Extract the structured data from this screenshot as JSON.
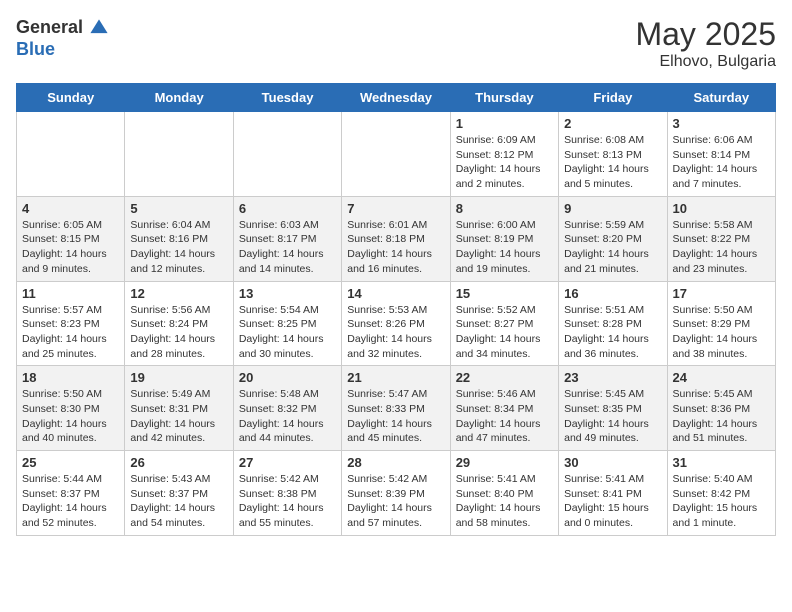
{
  "logo": {
    "general": "General",
    "blue": "Blue"
  },
  "title": {
    "month_year": "May 2025",
    "location": "Elhovo, Bulgaria"
  },
  "weekdays": [
    "Sunday",
    "Monday",
    "Tuesday",
    "Wednesday",
    "Thursday",
    "Friday",
    "Saturday"
  ],
  "weeks": [
    [
      {
        "day": "",
        "info": ""
      },
      {
        "day": "",
        "info": ""
      },
      {
        "day": "",
        "info": ""
      },
      {
        "day": "",
        "info": ""
      },
      {
        "day": "1",
        "info": "Sunrise: 6:09 AM\nSunset: 8:12 PM\nDaylight: 14 hours\nand 2 minutes."
      },
      {
        "day": "2",
        "info": "Sunrise: 6:08 AM\nSunset: 8:13 PM\nDaylight: 14 hours\nand 5 minutes."
      },
      {
        "day": "3",
        "info": "Sunrise: 6:06 AM\nSunset: 8:14 PM\nDaylight: 14 hours\nand 7 minutes."
      }
    ],
    [
      {
        "day": "4",
        "info": "Sunrise: 6:05 AM\nSunset: 8:15 PM\nDaylight: 14 hours\nand 9 minutes."
      },
      {
        "day": "5",
        "info": "Sunrise: 6:04 AM\nSunset: 8:16 PM\nDaylight: 14 hours\nand 12 minutes."
      },
      {
        "day": "6",
        "info": "Sunrise: 6:03 AM\nSunset: 8:17 PM\nDaylight: 14 hours\nand 14 minutes."
      },
      {
        "day": "7",
        "info": "Sunrise: 6:01 AM\nSunset: 8:18 PM\nDaylight: 14 hours\nand 16 minutes."
      },
      {
        "day": "8",
        "info": "Sunrise: 6:00 AM\nSunset: 8:19 PM\nDaylight: 14 hours\nand 19 minutes."
      },
      {
        "day": "9",
        "info": "Sunrise: 5:59 AM\nSunset: 8:20 PM\nDaylight: 14 hours\nand 21 minutes."
      },
      {
        "day": "10",
        "info": "Sunrise: 5:58 AM\nSunset: 8:22 PM\nDaylight: 14 hours\nand 23 minutes."
      }
    ],
    [
      {
        "day": "11",
        "info": "Sunrise: 5:57 AM\nSunset: 8:23 PM\nDaylight: 14 hours\nand 25 minutes."
      },
      {
        "day": "12",
        "info": "Sunrise: 5:56 AM\nSunset: 8:24 PM\nDaylight: 14 hours\nand 28 minutes."
      },
      {
        "day": "13",
        "info": "Sunrise: 5:54 AM\nSunset: 8:25 PM\nDaylight: 14 hours\nand 30 minutes."
      },
      {
        "day": "14",
        "info": "Sunrise: 5:53 AM\nSunset: 8:26 PM\nDaylight: 14 hours\nand 32 minutes."
      },
      {
        "day": "15",
        "info": "Sunrise: 5:52 AM\nSunset: 8:27 PM\nDaylight: 14 hours\nand 34 minutes."
      },
      {
        "day": "16",
        "info": "Sunrise: 5:51 AM\nSunset: 8:28 PM\nDaylight: 14 hours\nand 36 minutes."
      },
      {
        "day": "17",
        "info": "Sunrise: 5:50 AM\nSunset: 8:29 PM\nDaylight: 14 hours\nand 38 minutes."
      }
    ],
    [
      {
        "day": "18",
        "info": "Sunrise: 5:50 AM\nSunset: 8:30 PM\nDaylight: 14 hours\nand 40 minutes."
      },
      {
        "day": "19",
        "info": "Sunrise: 5:49 AM\nSunset: 8:31 PM\nDaylight: 14 hours\nand 42 minutes."
      },
      {
        "day": "20",
        "info": "Sunrise: 5:48 AM\nSunset: 8:32 PM\nDaylight: 14 hours\nand 44 minutes."
      },
      {
        "day": "21",
        "info": "Sunrise: 5:47 AM\nSunset: 8:33 PM\nDaylight: 14 hours\nand 45 minutes."
      },
      {
        "day": "22",
        "info": "Sunrise: 5:46 AM\nSunset: 8:34 PM\nDaylight: 14 hours\nand 47 minutes."
      },
      {
        "day": "23",
        "info": "Sunrise: 5:45 AM\nSunset: 8:35 PM\nDaylight: 14 hours\nand 49 minutes."
      },
      {
        "day": "24",
        "info": "Sunrise: 5:45 AM\nSunset: 8:36 PM\nDaylight: 14 hours\nand 51 minutes."
      }
    ],
    [
      {
        "day": "25",
        "info": "Sunrise: 5:44 AM\nSunset: 8:37 PM\nDaylight: 14 hours\nand 52 minutes."
      },
      {
        "day": "26",
        "info": "Sunrise: 5:43 AM\nSunset: 8:37 PM\nDaylight: 14 hours\nand 54 minutes."
      },
      {
        "day": "27",
        "info": "Sunrise: 5:42 AM\nSunset: 8:38 PM\nDaylight: 14 hours\nand 55 minutes."
      },
      {
        "day": "28",
        "info": "Sunrise: 5:42 AM\nSunset: 8:39 PM\nDaylight: 14 hours\nand 57 minutes."
      },
      {
        "day": "29",
        "info": "Sunrise: 5:41 AM\nSunset: 8:40 PM\nDaylight: 14 hours\nand 58 minutes."
      },
      {
        "day": "30",
        "info": "Sunrise: 5:41 AM\nSunset: 8:41 PM\nDaylight: 15 hours\nand 0 minutes."
      },
      {
        "day": "31",
        "info": "Sunrise: 5:40 AM\nSunset: 8:42 PM\nDaylight: 15 hours\nand 1 minute."
      }
    ]
  ]
}
